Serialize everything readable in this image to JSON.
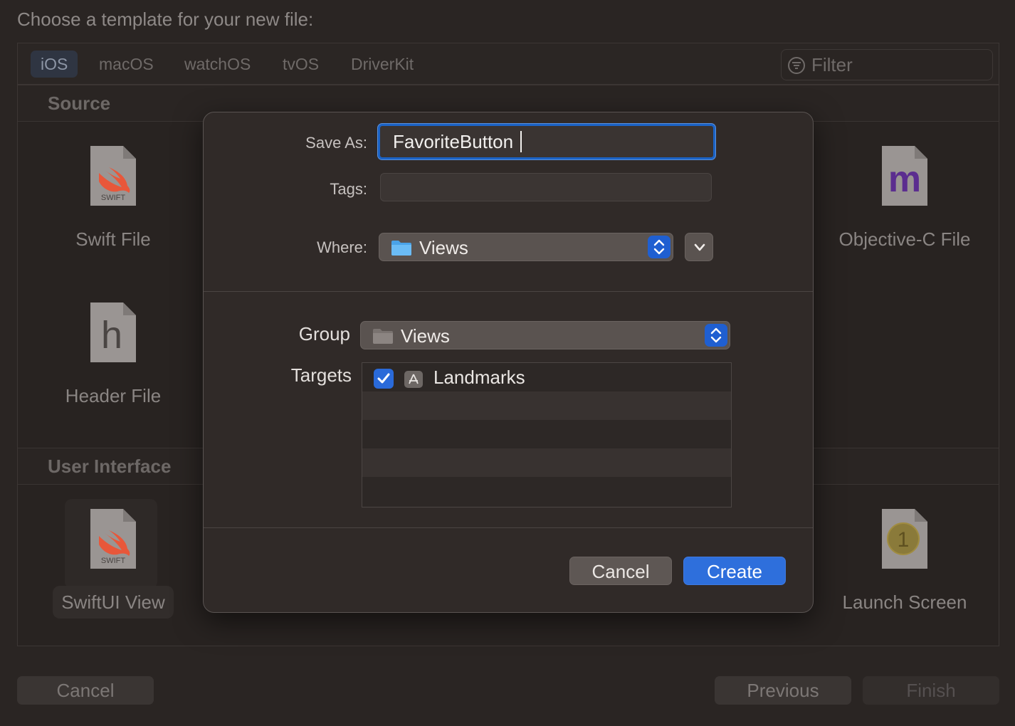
{
  "chooser": {
    "title": "Choose a template for your new file:",
    "platform_tabs": [
      {
        "label": "iOS",
        "active": true
      },
      {
        "label": "macOS",
        "active": false
      },
      {
        "label": "watchOS",
        "active": false
      },
      {
        "label": "tvOS",
        "active": false
      },
      {
        "label": "DriverKit",
        "active": false
      }
    ],
    "filter_placeholder": "Filter",
    "sections": [
      {
        "title": "Source"
      },
      {
        "title": "User Interface"
      }
    ],
    "templates": {
      "swift_file": {
        "label": "Swift File",
        "icon_text": "SWIFT"
      },
      "header_file": {
        "label": "Header File",
        "icon_text": "h"
      },
      "objc_file": {
        "label": "Objective-C File",
        "icon_text": "m"
      },
      "swiftui_view": {
        "label": "SwiftUI View",
        "icon_text": "SWIFT",
        "selected": true
      },
      "launch_screen": {
        "label": "Launch Screen",
        "icon_text": "1"
      }
    },
    "buttons": {
      "cancel": "Cancel",
      "previous": "Previous",
      "finish": "Finish"
    }
  },
  "save_sheet": {
    "save_as_label": "Save As:",
    "save_as_value": "FavoriteButton",
    "tags_label": "Tags:",
    "tags_value": "",
    "where_label": "Where:",
    "where_value": "Views",
    "group_label": "Group",
    "group_value": "Views",
    "targets_label": "Targets",
    "targets": [
      {
        "name": "Landmarks",
        "checked": true
      }
    ],
    "cancel_label": "Cancel",
    "create_label": "Create"
  },
  "colors": {
    "accent": "#2e6fdc",
    "focus_ring": "#1b63c6",
    "swift_orange": "#e8573a",
    "objc_purple": "#5b2d8f"
  }
}
